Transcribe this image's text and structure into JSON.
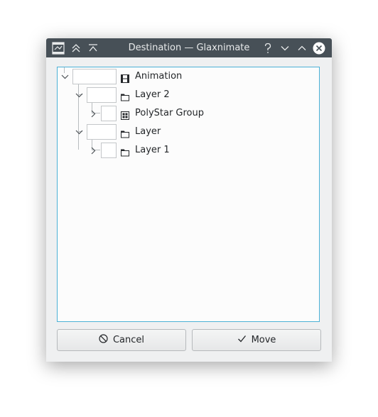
{
  "window": {
    "title": "Destination — Glaxnimate",
    "controls": [
      "help-icon",
      "minimize-icon",
      "maximize-icon",
      "close-icon"
    ]
  },
  "tree": {
    "items": [
      {
        "label": "Animation",
        "icon": "film-icon",
        "expanded": true
      },
      {
        "label": "Layer 2",
        "icon": "folder-icon",
        "expanded": true
      },
      {
        "label": "PolyStar Group",
        "icon": "group-icon",
        "expanded": false
      },
      {
        "label": "Layer",
        "icon": "folder-icon",
        "expanded": true
      },
      {
        "label": "Layer 1",
        "icon": "folder-icon",
        "expanded": false
      }
    ]
  },
  "buttons": {
    "cancel_label": "Cancel",
    "move_label": "Move"
  },
  "colors": {
    "titlebar": "#475057",
    "focus_border": "#4bb1d6",
    "window_bg": "#eff0f1"
  }
}
